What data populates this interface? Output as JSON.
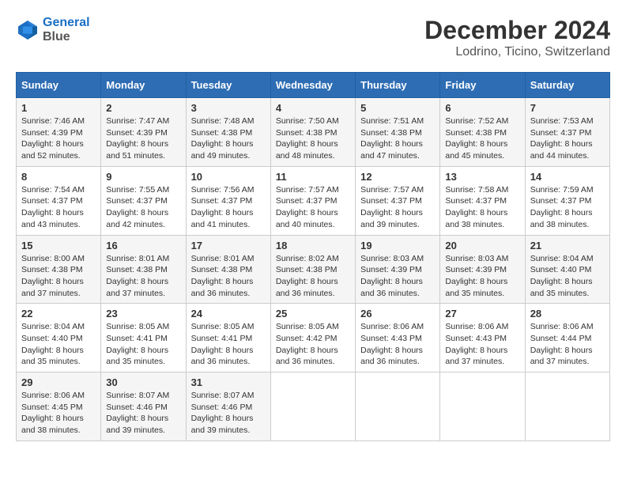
{
  "logo": {
    "line1": "General",
    "line2": "Blue"
  },
  "title": "December 2024",
  "subtitle": "Lodrino, Ticino, Switzerland",
  "days_header": [
    "Sunday",
    "Monday",
    "Tuesday",
    "Wednesday",
    "Thursday",
    "Friday",
    "Saturday"
  ],
  "weeks": [
    [
      {
        "day": "1",
        "sunrise": "Sunrise: 7:46 AM",
        "sunset": "Sunset: 4:39 PM",
        "daylight": "Daylight: 8 hours and 52 minutes."
      },
      {
        "day": "2",
        "sunrise": "Sunrise: 7:47 AM",
        "sunset": "Sunset: 4:39 PM",
        "daylight": "Daylight: 8 hours and 51 minutes."
      },
      {
        "day": "3",
        "sunrise": "Sunrise: 7:48 AM",
        "sunset": "Sunset: 4:38 PM",
        "daylight": "Daylight: 8 hours and 49 minutes."
      },
      {
        "day": "4",
        "sunrise": "Sunrise: 7:50 AM",
        "sunset": "Sunset: 4:38 PM",
        "daylight": "Daylight: 8 hours and 48 minutes."
      },
      {
        "day": "5",
        "sunrise": "Sunrise: 7:51 AM",
        "sunset": "Sunset: 4:38 PM",
        "daylight": "Daylight: 8 hours and 47 minutes."
      },
      {
        "day": "6",
        "sunrise": "Sunrise: 7:52 AM",
        "sunset": "Sunset: 4:38 PM",
        "daylight": "Daylight: 8 hours and 45 minutes."
      },
      {
        "day": "7",
        "sunrise": "Sunrise: 7:53 AM",
        "sunset": "Sunset: 4:37 PM",
        "daylight": "Daylight: 8 hours and 44 minutes."
      }
    ],
    [
      {
        "day": "8",
        "sunrise": "Sunrise: 7:54 AM",
        "sunset": "Sunset: 4:37 PM",
        "daylight": "Daylight: 8 hours and 43 minutes."
      },
      {
        "day": "9",
        "sunrise": "Sunrise: 7:55 AM",
        "sunset": "Sunset: 4:37 PM",
        "daylight": "Daylight: 8 hours and 42 minutes."
      },
      {
        "day": "10",
        "sunrise": "Sunrise: 7:56 AM",
        "sunset": "Sunset: 4:37 PM",
        "daylight": "Daylight: 8 hours and 41 minutes."
      },
      {
        "day": "11",
        "sunrise": "Sunrise: 7:57 AM",
        "sunset": "Sunset: 4:37 PM",
        "daylight": "Daylight: 8 hours and 40 minutes."
      },
      {
        "day": "12",
        "sunrise": "Sunrise: 7:57 AM",
        "sunset": "Sunset: 4:37 PM",
        "daylight": "Daylight: 8 hours and 39 minutes."
      },
      {
        "day": "13",
        "sunrise": "Sunrise: 7:58 AM",
        "sunset": "Sunset: 4:37 PM",
        "daylight": "Daylight: 8 hours and 38 minutes."
      },
      {
        "day": "14",
        "sunrise": "Sunrise: 7:59 AM",
        "sunset": "Sunset: 4:37 PM",
        "daylight": "Daylight: 8 hours and 38 minutes."
      }
    ],
    [
      {
        "day": "15",
        "sunrise": "Sunrise: 8:00 AM",
        "sunset": "Sunset: 4:38 PM",
        "daylight": "Daylight: 8 hours and 37 minutes."
      },
      {
        "day": "16",
        "sunrise": "Sunrise: 8:01 AM",
        "sunset": "Sunset: 4:38 PM",
        "daylight": "Daylight: 8 hours and 37 minutes."
      },
      {
        "day": "17",
        "sunrise": "Sunrise: 8:01 AM",
        "sunset": "Sunset: 4:38 PM",
        "daylight": "Daylight: 8 hours and 36 minutes."
      },
      {
        "day": "18",
        "sunrise": "Sunrise: 8:02 AM",
        "sunset": "Sunset: 4:38 PM",
        "daylight": "Daylight: 8 hours and 36 minutes."
      },
      {
        "day": "19",
        "sunrise": "Sunrise: 8:03 AM",
        "sunset": "Sunset: 4:39 PM",
        "daylight": "Daylight: 8 hours and 36 minutes."
      },
      {
        "day": "20",
        "sunrise": "Sunrise: 8:03 AM",
        "sunset": "Sunset: 4:39 PM",
        "daylight": "Daylight: 8 hours and 35 minutes."
      },
      {
        "day": "21",
        "sunrise": "Sunrise: 8:04 AM",
        "sunset": "Sunset: 4:40 PM",
        "daylight": "Daylight: 8 hours and 35 minutes."
      }
    ],
    [
      {
        "day": "22",
        "sunrise": "Sunrise: 8:04 AM",
        "sunset": "Sunset: 4:40 PM",
        "daylight": "Daylight: 8 hours and 35 minutes."
      },
      {
        "day": "23",
        "sunrise": "Sunrise: 8:05 AM",
        "sunset": "Sunset: 4:41 PM",
        "daylight": "Daylight: 8 hours and 35 minutes."
      },
      {
        "day": "24",
        "sunrise": "Sunrise: 8:05 AM",
        "sunset": "Sunset: 4:41 PM",
        "daylight": "Daylight: 8 hours and 36 minutes."
      },
      {
        "day": "25",
        "sunrise": "Sunrise: 8:05 AM",
        "sunset": "Sunset: 4:42 PM",
        "daylight": "Daylight: 8 hours and 36 minutes."
      },
      {
        "day": "26",
        "sunrise": "Sunrise: 8:06 AM",
        "sunset": "Sunset: 4:43 PM",
        "daylight": "Daylight: 8 hours and 36 minutes."
      },
      {
        "day": "27",
        "sunrise": "Sunrise: 8:06 AM",
        "sunset": "Sunset: 4:43 PM",
        "daylight": "Daylight: 8 hours and 37 minutes."
      },
      {
        "day": "28",
        "sunrise": "Sunrise: 8:06 AM",
        "sunset": "Sunset: 4:44 PM",
        "daylight": "Daylight: 8 hours and 37 minutes."
      }
    ],
    [
      {
        "day": "29",
        "sunrise": "Sunrise: 8:06 AM",
        "sunset": "Sunset: 4:45 PM",
        "daylight": "Daylight: 8 hours and 38 minutes."
      },
      {
        "day": "30",
        "sunrise": "Sunrise: 8:07 AM",
        "sunset": "Sunset: 4:46 PM",
        "daylight": "Daylight: 8 hours and 39 minutes."
      },
      {
        "day": "31",
        "sunrise": "Sunrise: 8:07 AM",
        "sunset": "Sunset: 4:46 PM",
        "daylight": "Daylight: 8 hours and 39 minutes."
      },
      null,
      null,
      null,
      null
    ]
  ]
}
